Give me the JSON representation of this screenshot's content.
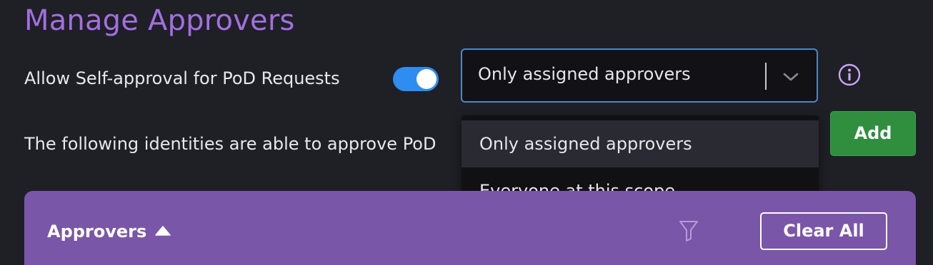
{
  "page": {
    "title": "Manage Approvers"
  },
  "self_approval": {
    "label": "Allow Self-approval for PoD Requests",
    "toggle_on": true,
    "toggle_color": "#2f8cf0"
  },
  "approver_select": {
    "selected": "Only assigned approvers",
    "options": [
      "Only assigned approvers",
      "Everyone at this scope"
    ],
    "border_color": "#4a88c9"
  },
  "info": {
    "icon": "info-icon"
  },
  "description": {
    "text": "The following identities are able to approve PoD"
  },
  "add_button": {
    "label": "Add",
    "color": "#2f8f3f"
  },
  "table": {
    "header_color": "#7a56a8",
    "column_label": "Approvers",
    "sort_icon": "triangle-up-icon",
    "filter_icon": "filter-icon",
    "clear_all_label": "Clear All"
  },
  "colors": {
    "title": "#a36fe0",
    "background": "#1f1f26"
  }
}
